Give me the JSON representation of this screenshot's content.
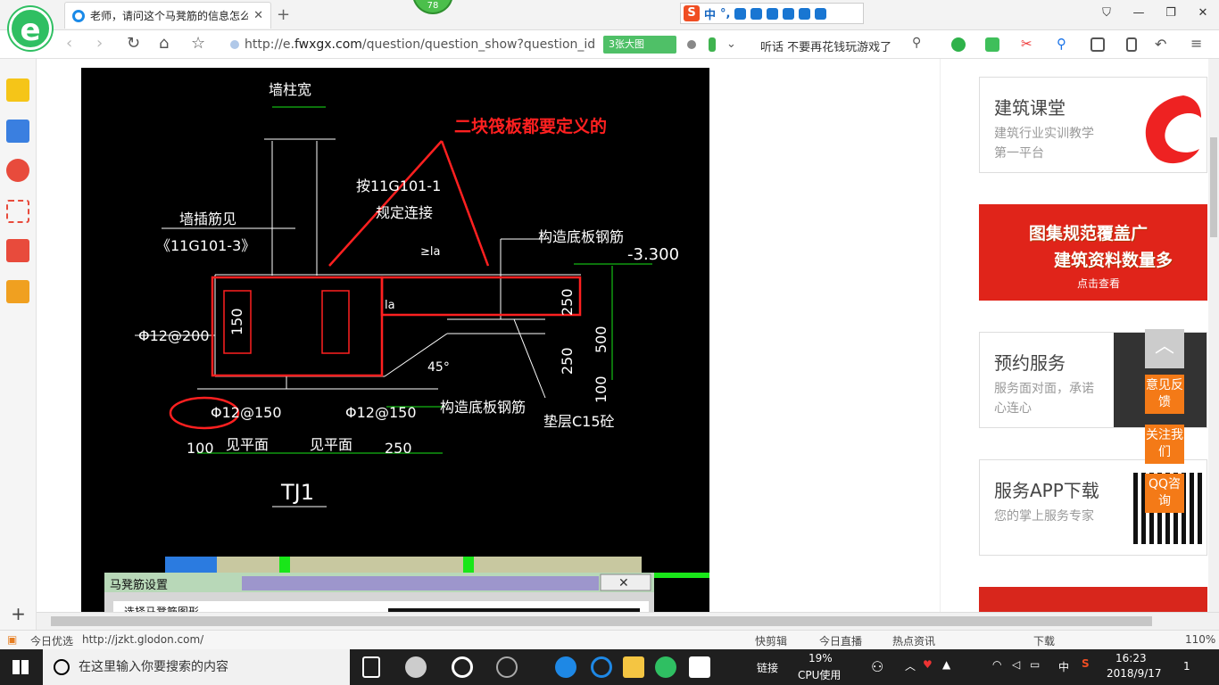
{
  "browser": {
    "tab_title": "老师，请问这个马凳筋的信息怎么",
    "badge": "78",
    "address": {
      "scheme": "http://e.",
      "host": "fwxgx.com",
      "path": "/question/question_show?question_id"
    },
    "big_image_button": "3张大图",
    "hot_search": "听话 不要再花钱玩游戏了",
    "ime": {
      "logo": "S",
      "mode": "中"
    }
  },
  "cad": {
    "annotation_red": "二块筏板都要定义的",
    "labels": {
      "wall_col_width": "墙柱宽",
      "per_spec": "按11G101-1",
      "per_spec_2": "规定连接",
      "wall_insert": "墙插筋见",
      "wall_insert_2": "《11G101-3》",
      "tf_bottom_top": "构造底板钢筋",
      "elevation": "-3.300",
      "la": "≥la",
      "la2": "la",
      "rebar1": "Φ12@200",
      "rebar2": "Φ12@150",
      "rebar3": "Φ12@150",
      "tf_bottom": "构造底板钢筋",
      "cushion": "垫层C15砼",
      "angle": "45°",
      "dim_150": "150",
      "dim_250a": "250",
      "dim_500": "500",
      "dim_250b": "250",
      "dim_100v": "100",
      "dim_100": "100",
      "see_plan1": "见平面",
      "see_plan2": "见平面",
      "dim_250h": "250",
      "name": "TJ1"
    },
    "dialog_title": "马凳筋设置",
    "dialog_sub": "选择马凳筋图形"
  },
  "right_panel": {
    "card1": {
      "title": "建筑课堂",
      "desc": "建筑行业实训教学第一平台"
    },
    "banner": {
      "line1": "图集规范覆盖广",
      "line2": "建筑资料数量多",
      "cta": "点击查看"
    },
    "card2": {
      "title": "预约服务",
      "desc": "服务面对面，承诺心连心"
    },
    "card3": {
      "title": "服务APP下载",
      "desc": "您的掌上服务专家"
    },
    "float": {
      "feedback": "意见反馈",
      "follow": "关注我们",
      "qq": "QQ咨询"
    }
  },
  "status_bar": {
    "left": "今日优选",
    "url": "http://jzkt.glodon.com/",
    "items": [
      "快剪辑",
      "今日直播",
      "热点资讯",
      "下载",
      "110%"
    ]
  },
  "taskbar": {
    "search_placeholder": "在这里输入你要搜索的内容",
    "link": "链接",
    "cpu_pct": "19%",
    "cpu_label": "CPU使用",
    "ime": "中",
    "time": "16:23",
    "date": "2018/9/17",
    "notif": "1"
  },
  "colors": {
    "accent": "#2fbf62",
    "cad_bg": "#000000",
    "red": "#ff2020"
  }
}
